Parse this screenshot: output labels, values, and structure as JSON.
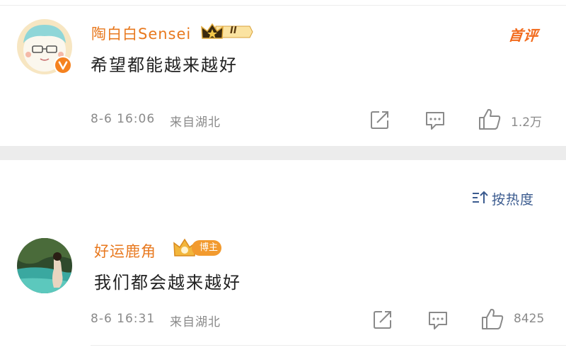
{
  "comments": [
    {
      "username": "陶白白Sensei",
      "vip_level": "II",
      "badge": "首评",
      "text": "希望都能越来越好",
      "time": "8-6 16:06",
      "location": "来自湖北",
      "likes": "1.2万"
    },
    {
      "username": "好运鹿角",
      "badge": "博主",
      "text": "我们都会越来越好",
      "time": "8-6 16:31",
      "location": "来自湖北",
      "likes": "8425"
    }
  ],
  "sort": {
    "label": "按热度"
  },
  "icons": [
    "share-icon",
    "comment-icon",
    "like-icon",
    "sort-icon",
    "verified-v-icon",
    "vip-crown-icon"
  ],
  "colors": {
    "username": "#e8791f",
    "meta": "#8a8a8a",
    "sort": "#3b5b8f",
    "badge": "#f26b1d"
  }
}
